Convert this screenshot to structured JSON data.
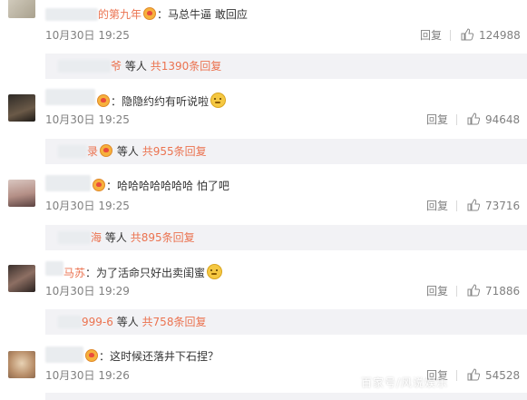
{
  "comments": [
    {
      "name_fragment": "的第九年",
      "colon": "：",
      "text": "马总牛逼 敢回应",
      "has_emoji": false,
      "time": "10月30日 19:25",
      "reply_label": "回复",
      "likes": "124988",
      "sub_name_fragment": "爷",
      "sub_and_others": "等人",
      "sub_total": "共1390条回复"
    },
    {
      "name_fragment": "",
      "colon": "：",
      "text": "隐隐约约有听说啦",
      "has_emoji": true,
      "time": "10月30日 19:25",
      "reply_label": "回复",
      "likes": "94648",
      "sub_name_fragment": "录",
      "sub_and_others": "等人",
      "sub_total": "共955条回复"
    },
    {
      "name_fragment": "",
      "colon": "：",
      "text": "哈哈哈哈哈哈哈 怕了吧",
      "has_emoji": false,
      "time": "10月30日 19:25",
      "reply_label": "回复",
      "likes": "73716",
      "sub_name_fragment": "海",
      "sub_and_others": "等人",
      "sub_total": "共895条回复"
    },
    {
      "name_fragment": "马苏",
      "colon": "：",
      "text": "为了活命只好出卖闺蜜",
      "has_emoji": true,
      "time": "10月30日 19:29",
      "reply_label": "回复",
      "likes": "71886",
      "sub_name_fragment": "999-6",
      "sub_and_others": "等人",
      "sub_total": "共758条回复"
    },
    {
      "name_fragment": "",
      "colon": "：",
      "text": "这时候还落井下石捏？",
      "has_emoji": false,
      "time": "10月30日 19:26",
      "reply_label": "回复",
      "likes": "54528"
    }
  ],
  "watermark": "百家号/风说娱乐"
}
